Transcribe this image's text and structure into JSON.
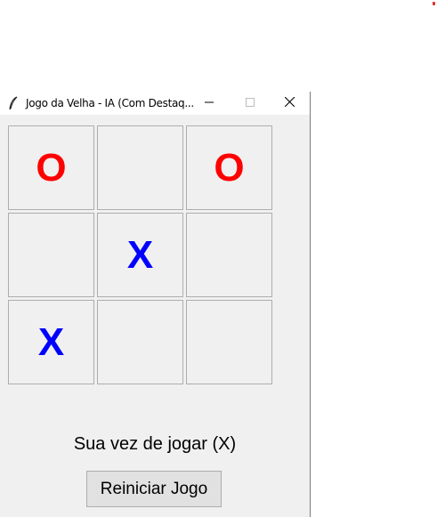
{
  "window": {
    "title": "Jogo da Velha - IA (Com Destaq...",
    "icon": "feather-icon",
    "controls": [
      "minimize-icon",
      "maximize-icon",
      "close-icon"
    ]
  },
  "board": {
    "cells": [
      {
        "mark": "O"
      },
      {
        "mark": ""
      },
      {
        "mark": "O"
      },
      {
        "mark": ""
      },
      {
        "mark": "X"
      },
      {
        "mark": ""
      },
      {
        "mark": "X"
      },
      {
        "mark": ""
      },
      {
        "mark": ""
      }
    ],
    "colors": {
      "X": "#0000ff",
      "O": "#ff0000"
    }
  },
  "status": {
    "text": "Sua vez de jogar (X)"
  },
  "restart": {
    "label": "Reiniciar Jogo"
  }
}
